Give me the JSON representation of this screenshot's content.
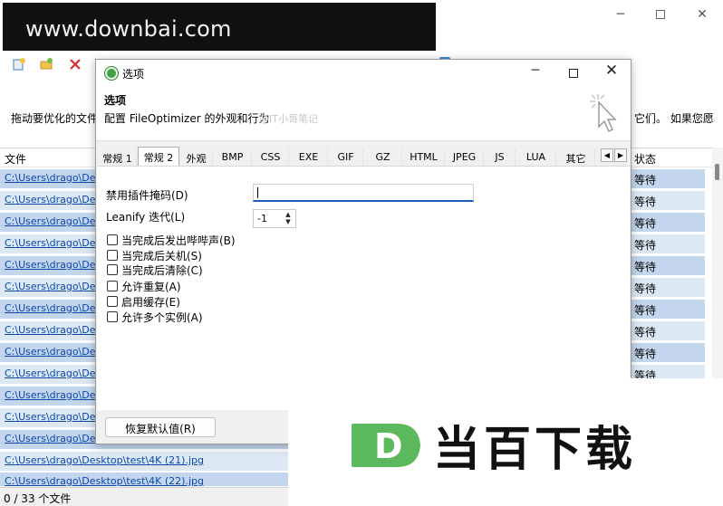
{
  "watermark": {
    "text": "www.downbai.com"
  },
  "main": {
    "drop_hint_left": "拖动要优化的文件",
    "drop_hint_right": "它们。 如果您愿",
    "list": {
      "col_file": "文件",
      "col_status": "状态",
      "rows": [
        {
          "path": "C:\\Users\\drago\\Desk",
          "status": "等待"
        },
        {
          "path": "C:\\Users\\drago\\Desk",
          "status": "等待"
        },
        {
          "path": "C:\\Users\\drago\\Desk",
          "status": "等待"
        },
        {
          "path": "C:\\Users\\drago\\Desk",
          "status": "等待"
        },
        {
          "path": "C:\\Users\\drago\\Desk",
          "status": "等待"
        },
        {
          "path": "C:\\Users\\drago\\Desk",
          "status": "等待"
        },
        {
          "path": "C:\\Users\\drago\\Desk",
          "status": "等待"
        },
        {
          "path": "C:\\Users\\drago\\Desk",
          "status": "等待"
        },
        {
          "path": "C:\\Users\\drago\\Desk",
          "status": "等待"
        },
        {
          "path": "C:\\Users\\drago\\Desk",
          "status": "等待"
        },
        {
          "path": "C:\\Users\\drago\\Desk",
          "status": ""
        },
        {
          "path": "C:\\Users\\drago\\Desk",
          "status": ""
        },
        {
          "path": "C:\\Users\\drago\\Desk",
          "status": ""
        },
        {
          "path": "C:\\Users\\drago\\Desktop\\test\\4K (21).jpg",
          "status": ""
        },
        {
          "path": "C:\\Users\\drago\\Desktop\\test\\4K (22).jpg",
          "status": ""
        }
      ]
    },
    "status_bar": "0 / 33 个文件"
  },
  "dialog": {
    "title": "选项",
    "heading": "选项",
    "subtitle": "配置 FileOptimizer 的外观和行为",
    "subtitle_watermark": "@IT小哥笔记",
    "tabs": [
      "常规 1",
      "常规 2",
      "外观",
      "BMP",
      "CSS",
      "EXE",
      "GIF",
      "GZ",
      "HTML",
      "JPEG",
      "JS",
      "LUA",
      "其它"
    ],
    "active_tab": "常规 2",
    "fields": {
      "disable_plugin_mask_label": "禁用插件掩码(D)",
      "disable_plugin_mask_value": "",
      "leanify_label": "Leanify 迭代(L)",
      "leanify_value": "-1"
    },
    "checkboxes": [
      {
        "label": "当完成后发出哔哔声(B)",
        "checked": false
      },
      {
        "label": "当完成后关机(S)",
        "checked": false
      },
      {
        "label": "当完成后清除(C)",
        "checked": false
      },
      {
        "label": "允许重复(A)",
        "checked": false
      },
      {
        "label": "启用缓存(E)",
        "checked": false
      },
      {
        "label": "允许多个实例(A)",
        "checked": false
      }
    ],
    "restore_button": "恢复默认值(R)"
  },
  "brand": {
    "text": "当百下载",
    "logo_letter": "D"
  },
  "colors": {
    "link": "#0a47a8",
    "row_selected": "#c3d6ee",
    "row_plain": "#dde8f5",
    "brand_green": "#5cb85c",
    "app_green": "#3fa33f"
  }
}
